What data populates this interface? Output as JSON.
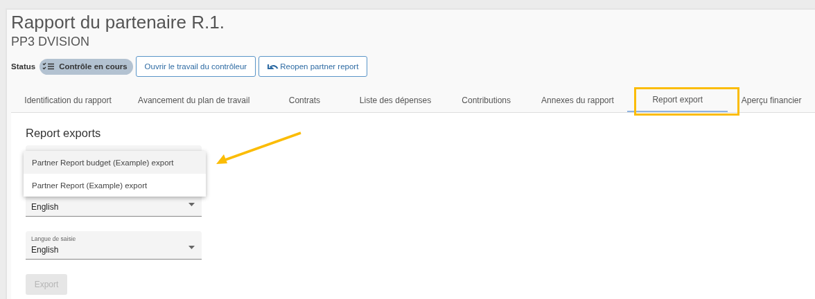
{
  "header": {
    "title": "Rapport du partenaire R.1.",
    "subtitle": "PP3 DVISION"
  },
  "status": {
    "label": "Status",
    "value": "Contrôle en cours"
  },
  "actions": [
    {
      "label": "Ouvrir le travail du contrôleur",
      "kind": "plain"
    },
    {
      "label": "Reopen partner report",
      "kind": "undo"
    }
  ],
  "tabs": [
    {
      "label": "Identification du rapport",
      "selected": false
    },
    {
      "label": "Avancement du plan de travail",
      "selected": false
    },
    {
      "label": "Contrats",
      "selected": false
    },
    {
      "label": "Liste des dépenses",
      "selected": false
    },
    {
      "label": "Contributions",
      "selected": false
    },
    {
      "label": "Annexes du rapport",
      "selected": false
    },
    {
      "label": "Report export",
      "selected": true
    },
    {
      "label": "Aperçu financier",
      "selected": false
    }
  ],
  "panel": {
    "title": "Report exports",
    "fields": [
      {
        "kind": "covered"
      },
      {
        "kind": "select",
        "value": "English"
      },
      {
        "kind": "select",
        "label": "Langue de saisie",
        "value": "English"
      }
    ],
    "menu": [
      {
        "label": "Partner Report budget (Example) export",
        "highlighted": true
      },
      {
        "label": "Partner Report (Example) export",
        "highlighted": false
      }
    ],
    "export_button": {
      "label": "Export",
      "disabled": true
    }
  }
}
